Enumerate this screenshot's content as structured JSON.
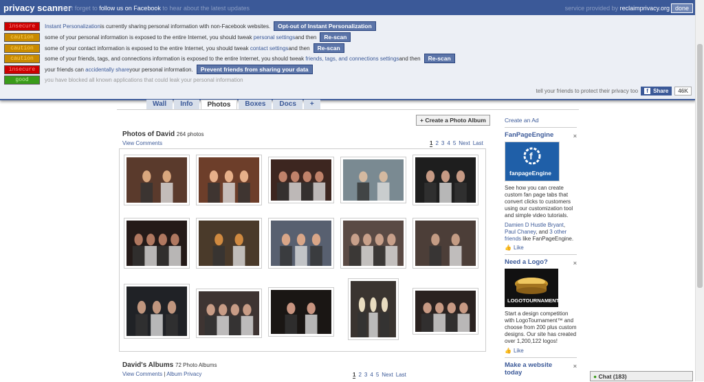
{
  "scanner": {
    "title": "privacy scanner",
    "follow_pre": "don't forget to",
    "follow_mid": "follow us on Facebook",
    "follow_post": "to hear about the latest updates",
    "service_pre": "service provided by",
    "service_site": "reclaimprivacy.org",
    "done_label": "done",
    "rows": [
      {
        "badge": "insecure",
        "level": "red",
        "pre": "",
        "link": "Instant Personalization",
        "post": " is currently sharing personal information with non-Facebook websites.",
        "post2": "",
        "link2": "",
        "post3": "",
        "button": "Opt-out of Instant Personalization"
      },
      {
        "badge": "caution",
        "level": "caution",
        "pre": "some of your personal information is exposed to the entire Internet, you should tweak ",
        "link": "personal settings",
        "post": " and then",
        "post2": "",
        "link2": "",
        "post3": "",
        "button": "Re-scan"
      },
      {
        "badge": "caution",
        "level": "caution",
        "pre": "some of your contact information is exposed to the entire Internet, you should tweak ",
        "link": "contact settings",
        "post": " and then",
        "post2": "",
        "link2": "",
        "post3": "",
        "button": "Re-scan"
      },
      {
        "badge": "caution",
        "level": "caution",
        "pre": "some of your friends, tags, and connections information is exposed to the entire Internet, you should tweak ",
        "link": "friends, tags, and connections settings",
        "post": " and then",
        "post2": "",
        "link2": "",
        "post3": "",
        "button": "Re-scan"
      },
      {
        "badge": "insecure",
        "level": "red",
        "pre": "your friends can ",
        "link": "accidentally share",
        "post": " your personal information.",
        "post2": "",
        "link2": "",
        "post3": "",
        "button": "Prevent friends from sharing your data"
      },
      {
        "badge": "good",
        "level": "good",
        "pre": "you have blocked all known applications that could leak your personal information",
        "link": "",
        "post": "",
        "post2": "",
        "link2": "",
        "post3": "",
        "button": ""
      }
    ],
    "footer_text": "tell your friends to protect their privacy too",
    "share_label": "Share",
    "share_count": "46K"
  },
  "tabs": [
    "Wall",
    "Info",
    "Photos",
    "Boxes",
    "Docs",
    "+"
  ],
  "active_tab": "Photos",
  "photos": {
    "create_album": "+ Create a Photo Album",
    "title": "Photos of David",
    "count": "264 photos",
    "view_comments": "View Comments",
    "pager": [
      "1",
      "2",
      "3",
      "4",
      "5",
      "Next",
      "Last"
    ],
    "thumbs": [
      {
        "bg": "#5a3a2c",
        "fg": "#d9a77e"
      },
      {
        "bg": "#6d3e2a",
        "fg": "#e7b08a"
      },
      {
        "bg": "#3d2620",
        "fg": "#c0826a"
      },
      {
        "bg": "#7a8a92",
        "fg": "#d4b9a0"
      },
      {
        "bg": "#1e1e1e",
        "fg": "#c69a84"
      },
      {
        "bg": "#241a18",
        "fg": "#b07860"
      },
      {
        "bg": "#4a3a2a",
        "fg": "#d08a40"
      },
      {
        "bg": "#586070",
        "fg": "#d9a688"
      },
      {
        "bg": "#5a4a44",
        "fg": "#c8a08a"
      },
      {
        "bg": "#4c3e38",
        "fg": "#c49c84"
      },
      {
        "bg": "#202226",
        "fg": "#c0967e"
      },
      {
        "bg": "#3e3432",
        "fg": "#c89c86"
      },
      {
        "bg": "#1a1614",
        "fg": "#c89480"
      },
      {
        "bg": "#3a3430",
        "fg": "#e8dcc0"
      },
      {
        "bg": "#2a2220",
        "fg": "#c89a84"
      }
    ]
  },
  "albums": {
    "title": "David's Albums",
    "count": "72 Photo Albums",
    "view_comments": "View Comments",
    "separator": "|",
    "album_privacy": "Album Privacy",
    "pager": [
      "1",
      "2",
      "3",
      "4",
      "5",
      "Next",
      "Last"
    ]
  },
  "sidebar": {
    "create_ad": "Create an Ad",
    "ads": [
      {
        "title": "FanPageEngine",
        "close": "×",
        "logo_text": "fanpageEngine",
        "body": "See how you can create custom fan page tabs that convert clicks to customers using our customization tool and simple video tutorials.",
        "friends_a": "Damien D Hustle Bryant",
        "friends_comma": ", ",
        "friends_b": "Paul Chaney",
        "friends_c": ", and ",
        "friends_d": "3 other friends",
        "friends_e": " like FanPageEngine.",
        "like": "Like"
      },
      {
        "title": "Need a Logo?",
        "close": "×",
        "logo_text": "LOGOTOURNAMENT",
        "body": "Start a design competition with LogoTournament™ and choose from 200 plus custom designs. Our site has created over 1,200,122 logos!",
        "like": "Like"
      },
      {
        "title": "Make a website today",
        "close": "×"
      }
    ]
  },
  "chat": {
    "label": "Chat (183)"
  },
  "colors": {
    "brand": "#3b5998",
    "insecure": "#cc0000",
    "caution": "#c88a00",
    "good": "#3a9b1a"
  }
}
